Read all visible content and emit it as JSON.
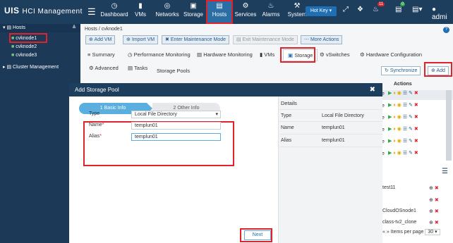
{
  "app": {
    "logo": "UIS",
    "title": "HCI Management"
  },
  "nav": [
    {
      "label": "Dashboard",
      "icon": "speedometer-icon"
    },
    {
      "label": "VMs",
      "icon": "monitor-icon"
    },
    {
      "label": "Networks",
      "icon": "globe-icon"
    },
    {
      "label": "Storage",
      "icon": "database-icon"
    },
    {
      "label": "Hosts",
      "icon": "server-icon"
    },
    {
      "label": "Services",
      "icon": "gear-icon"
    },
    {
      "label": "Alarms",
      "icon": "bell-icon"
    },
    {
      "label": "System",
      "icon": "wrench-icon"
    }
  ],
  "topright": {
    "hotkey": "Hot Key",
    "alarm_count": "11",
    "task_count": "0",
    "user": "admi"
  },
  "sidebar": {
    "hosts_label": "Hosts",
    "hosts": [
      "cvknode1",
      "cvknode2",
      "cvknode3"
    ],
    "cluster_label": "Cluster Management"
  },
  "breadcrumb": {
    "root": "Hosts",
    "current": "cvknode1"
  },
  "toolbar": [
    "Add VM",
    "Import VM",
    "Enter Maintenance Mode",
    "Exit Maintenance Mode",
    "More Actions"
  ],
  "tabs": [
    "Summary",
    "Performance Monitoring",
    "Hardware Monitoring",
    "VMs",
    "Storage",
    "vSwitches",
    "Hardware Configuration",
    "Advanced",
    "Tasks"
  ],
  "storage": {
    "title": "Storage Pools",
    "synchronize": "Synchronize",
    "add": "Add",
    "actions_header": "Actions",
    "row_tail": "e",
    "lower_rows": [
      "test11",
      "CloudOSnode1",
      "class-tv2_clone"
    ],
    "per_page_label": "Items per page",
    "per_page_value": "30"
  },
  "dialog": {
    "title": "Add Storage Pool",
    "step1": "1 Basic Info",
    "step2": "2 Other Info",
    "type_label": "Type",
    "type_value": "Local File Directory",
    "name_label": "Name",
    "name_value": "templun01",
    "alias_label": "Alias",
    "alias_value": "templun01",
    "next": "Next",
    "details_title": "Details",
    "details": [
      {
        "key": "Type",
        "value": "Local File Directory"
      },
      {
        "key": "Name",
        "value": "templun01"
      },
      {
        "key": "Alias",
        "value": "templun01"
      }
    ]
  },
  "colors": {
    "topbar": "#1e3e5e",
    "accent": "#1f6fb5",
    "highlight": "#e0232b",
    "step_active": "#5aaee0"
  }
}
